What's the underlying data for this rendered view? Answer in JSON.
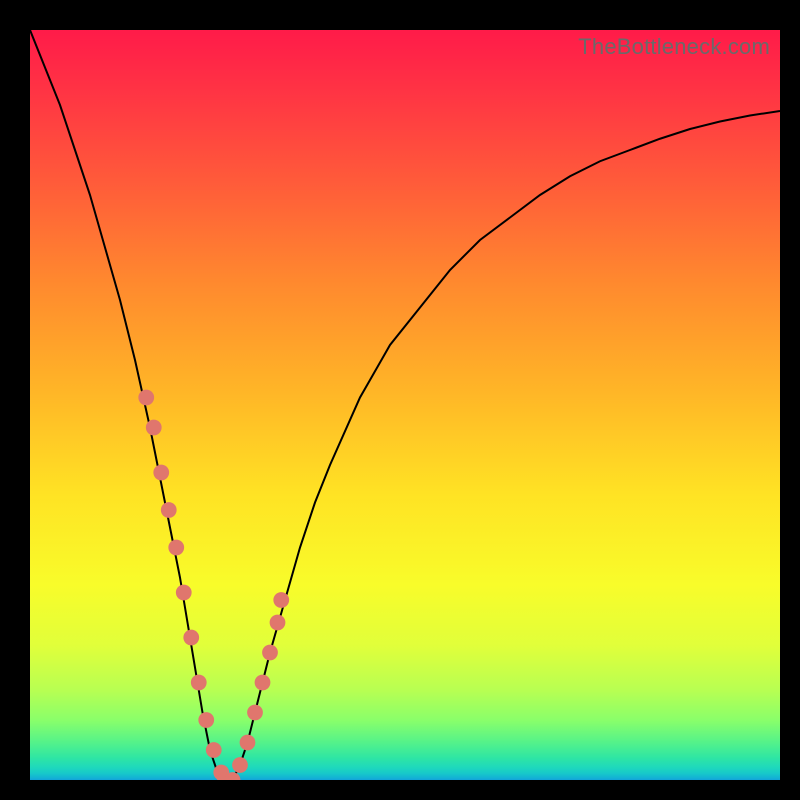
{
  "watermark": "TheBottleneck.com",
  "chart_data": {
    "type": "line",
    "title": "",
    "xlabel": "",
    "ylabel": "",
    "xlim": [
      0,
      100
    ],
    "ylim": [
      0,
      100
    ],
    "grid": false,
    "series": [
      {
        "name": "curve",
        "x": [
          0,
          2,
          4,
          6,
          8,
          10,
          12,
          14,
          16,
          18,
          19,
          20,
          21,
          22,
          23,
          24,
          25,
          26,
          27,
          28,
          29,
          30,
          32,
          34,
          36,
          38,
          40,
          44,
          48,
          52,
          56,
          60,
          64,
          68,
          72,
          76,
          80,
          84,
          88,
          92,
          96,
          100
        ],
        "y": [
          100,
          95,
          90,
          84,
          78,
          71,
          64,
          56,
          47,
          37,
          32,
          27,
          21,
          15,
          9,
          4,
          1,
          0,
          0,
          2,
          5,
          9,
          17,
          24,
          31,
          37,
          42,
          51,
          58,
          63,
          68,
          72,
          75,
          78,
          80.5,
          82.5,
          84,
          85.5,
          86.8,
          87.8,
          88.6,
          89.2
        ]
      },
      {
        "name": "markers",
        "x": [
          15.5,
          16.5,
          17.5,
          18.5,
          19.5,
          20.5,
          21.5,
          22.5,
          23.5,
          24.5,
          25.5,
          26.0,
          27.0,
          28.0,
          29.0,
          30.0,
          31.0,
          32.0,
          33.0,
          33.5
        ],
        "y": [
          51,
          47,
          41,
          36,
          31,
          25,
          19,
          13,
          8,
          4,
          1,
          0,
          0,
          2,
          5,
          9,
          13,
          17,
          21,
          24
        ]
      }
    ],
    "marker_color": "#e0766d",
    "marker_radius_percent": 1.05,
    "background_gradient": {
      "stops": [
        {
          "pos": 0.0,
          "color": "#ff1b49"
        },
        {
          "pos": 0.08,
          "color": "#ff3344"
        },
        {
          "pos": 0.2,
          "color": "#ff5a3a"
        },
        {
          "pos": 0.34,
          "color": "#ff8a2e"
        },
        {
          "pos": 0.48,
          "color": "#ffb527"
        },
        {
          "pos": 0.62,
          "color": "#ffe324"
        },
        {
          "pos": 0.74,
          "color": "#f8fc2a"
        },
        {
          "pos": 0.82,
          "color": "#e1ff3a"
        },
        {
          "pos": 0.88,
          "color": "#b8ff52"
        },
        {
          "pos": 0.92,
          "color": "#8aff6a"
        },
        {
          "pos": 0.95,
          "color": "#54f28a"
        },
        {
          "pos": 0.97,
          "color": "#2fe6a3"
        },
        {
          "pos": 0.983,
          "color": "#1fd9bc"
        },
        {
          "pos": 0.991,
          "color": "#17c9c9"
        },
        {
          "pos": 0.996,
          "color": "#14b7d2"
        },
        {
          "pos": 1.0,
          "color": "#12a4da"
        }
      ]
    }
  }
}
